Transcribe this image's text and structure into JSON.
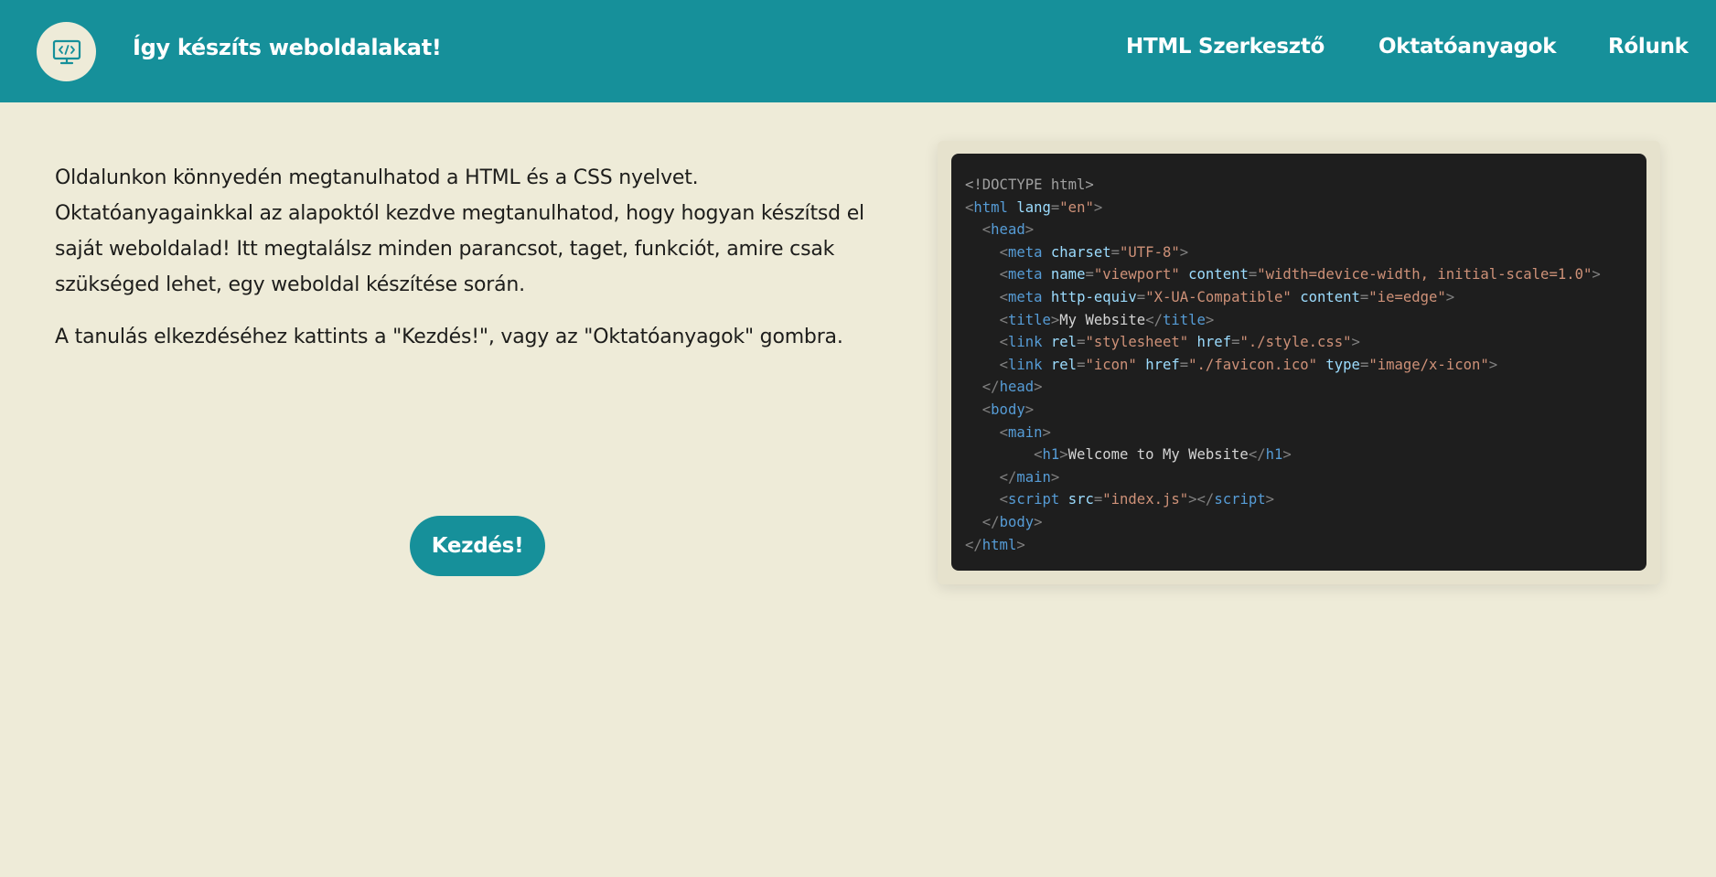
{
  "header": {
    "site_title": "Így készíts weboldalakat!",
    "logo_icon": "code-monitor-icon",
    "nav": [
      {
        "label": "HTML Szerkesztő"
      },
      {
        "label": "Oktatóanyagok"
      },
      {
        "label": "Rólunk"
      }
    ]
  },
  "intro": {
    "paragraph1": "Oldalunkon könnyedén megtanulhatod a HTML és a CSS nyelvet. Oktatóanyagainkkal az alapoktól kezdve megtanulhatod, hogy hogyan készítsd el saját weboldalad! Itt megtalálsz minden parancsot, taget, funkciót, amire csak szükséged lehet, egy weboldal készítése során.",
    "paragraph2": "A tanulás elkezdéséhez kattints a \"Kezdés!\", vagy az \"Oktatóanyagok\" gombra."
  },
  "start_button": {
    "label": "Kezdés!"
  },
  "colors": {
    "accent": "#16909a",
    "background": "#eeebd8",
    "code_bg": "#1e1e1e"
  },
  "code_sample": {
    "lines": [
      {
        "indent": 0,
        "tokens": [
          {
            "t": "doc",
            "v": "<!DOCTYPE html>"
          }
        ]
      },
      {
        "indent": 0,
        "tokens": [
          {
            "t": "punc",
            "v": "<"
          },
          {
            "t": "tag",
            "v": "html"
          },
          {
            "t": "text",
            "v": " "
          },
          {
            "t": "attr",
            "v": "lang"
          },
          {
            "t": "punc",
            "v": "="
          },
          {
            "t": "str",
            "v": "\"en\""
          },
          {
            "t": "punc",
            "v": ">"
          }
        ]
      },
      {
        "indent": 2,
        "tokens": [
          {
            "t": "punc",
            "v": "<"
          },
          {
            "t": "tag",
            "v": "head"
          },
          {
            "t": "punc",
            "v": ">"
          }
        ]
      },
      {
        "indent": 4,
        "tokens": [
          {
            "t": "punc",
            "v": "<"
          },
          {
            "t": "tag",
            "v": "meta"
          },
          {
            "t": "text",
            "v": " "
          },
          {
            "t": "attr",
            "v": "charset"
          },
          {
            "t": "punc",
            "v": "="
          },
          {
            "t": "str",
            "v": "\"UTF-8\""
          },
          {
            "t": "punc",
            "v": ">"
          }
        ]
      },
      {
        "indent": 4,
        "tokens": [
          {
            "t": "punc",
            "v": "<"
          },
          {
            "t": "tag",
            "v": "meta"
          },
          {
            "t": "text",
            "v": " "
          },
          {
            "t": "attr",
            "v": "name"
          },
          {
            "t": "punc",
            "v": "="
          },
          {
            "t": "str",
            "v": "\"viewport\""
          },
          {
            "t": "text",
            "v": " "
          },
          {
            "t": "attr",
            "v": "content"
          },
          {
            "t": "punc",
            "v": "="
          },
          {
            "t": "str",
            "v": "\"width=device-width, initial-scale=1.0\""
          },
          {
            "t": "punc",
            "v": ">"
          }
        ]
      },
      {
        "indent": 4,
        "tokens": [
          {
            "t": "punc",
            "v": "<"
          },
          {
            "t": "tag",
            "v": "meta"
          },
          {
            "t": "text",
            "v": " "
          },
          {
            "t": "attr",
            "v": "http-equiv"
          },
          {
            "t": "punc",
            "v": "="
          },
          {
            "t": "str",
            "v": "\"X-UA-Compatible\""
          },
          {
            "t": "text",
            "v": " "
          },
          {
            "t": "attr",
            "v": "content"
          },
          {
            "t": "punc",
            "v": "="
          },
          {
            "t": "str",
            "v": "\"ie=edge\""
          },
          {
            "t": "punc",
            "v": ">"
          }
        ]
      },
      {
        "indent": 4,
        "tokens": [
          {
            "t": "punc",
            "v": "<"
          },
          {
            "t": "tag",
            "v": "title"
          },
          {
            "t": "punc",
            "v": ">"
          },
          {
            "t": "text",
            "v": "My Website"
          },
          {
            "t": "punc",
            "v": "</"
          },
          {
            "t": "tag",
            "v": "title"
          },
          {
            "t": "punc",
            "v": ">"
          }
        ]
      },
      {
        "indent": 4,
        "tokens": [
          {
            "t": "punc",
            "v": "<"
          },
          {
            "t": "tag",
            "v": "link"
          },
          {
            "t": "text",
            "v": " "
          },
          {
            "t": "attr",
            "v": "rel"
          },
          {
            "t": "punc",
            "v": "="
          },
          {
            "t": "str",
            "v": "\"stylesheet\""
          },
          {
            "t": "text",
            "v": " "
          },
          {
            "t": "attr",
            "v": "href"
          },
          {
            "t": "punc",
            "v": "="
          },
          {
            "t": "str",
            "v": "\"./style.css\""
          },
          {
            "t": "punc",
            "v": ">"
          }
        ]
      },
      {
        "indent": 4,
        "tokens": [
          {
            "t": "punc",
            "v": "<"
          },
          {
            "t": "tag",
            "v": "link"
          },
          {
            "t": "text",
            "v": " "
          },
          {
            "t": "attr",
            "v": "rel"
          },
          {
            "t": "punc",
            "v": "="
          },
          {
            "t": "str",
            "v": "\"icon\""
          },
          {
            "t": "text",
            "v": " "
          },
          {
            "t": "attr",
            "v": "href"
          },
          {
            "t": "punc",
            "v": "="
          },
          {
            "t": "str",
            "v": "\"./favicon.ico\""
          },
          {
            "t": "text",
            "v": " "
          },
          {
            "t": "attr",
            "v": "type"
          },
          {
            "t": "punc",
            "v": "="
          },
          {
            "t": "str",
            "v": "\"image/x-icon\""
          },
          {
            "t": "punc",
            "v": ">"
          }
        ]
      },
      {
        "indent": 2,
        "tokens": [
          {
            "t": "punc",
            "v": "</"
          },
          {
            "t": "tag",
            "v": "head"
          },
          {
            "t": "punc",
            "v": ">"
          }
        ]
      },
      {
        "indent": 2,
        "tokens": [
          {
            "t": "punc",
            "v": "<"
          },
          {
            "t": "tag",
            "v": "body"
          },
          {
            "t": "punc",
            "v": ">"
          }
        ]
      },
      {
        "indent": 4,
        "tokens": [
          {
            "t": "punc",
            "v": "<"
          },
          {
            "t": "tag",
            "v": "main"
          },
          {
            "t": "punc",
            "v": ">"
          }
        ]
      },
      {
        "indent": 8,
        "tokens": [
          {
            "t": "punc",
            "v": "<"
          },
          {
            "t": "tag",
            "v": "h1"
          },
          {
            "t": "punc",
            "v": ">"
          },
          {
            "t": "text",
            "v": "Welcome to My Website"
          },
          {
            "t": "punc",
            "v": "</"
          },
          {
            "t": "tag",
            "v": "h1"
          },
          {
            "t": "punc",
            "v": ">"
          }
        ]
      },
      {
        "indent": 4,
        "tokens": [
          {
            "t": "punc",
            "v": "</"
          },
          {
            "t": "tag",
            "v": "main"
          },
          {
            "t": "punc",
            "v": ">"
          }
        ]
      },
      {
        "indent": 4,
        "tokens": [
          {
            "t": "punc",
            "v": "<"
          },
          {
            "t": "tag",
            "v": "script"
          },
          {
            "t": "text",
            "v": " "
          },
          {
            "t": "attr",
            "v": "src"
          },
          {
            "t": "punc",
            "v": "="
          },
          {
            "t": "str",
            "v": "\"index.js\""
          },
          {
            "t": "punc",
            "v": "></"
          },
          {
            "t": "tag",
            "v": "script"
          },
          {
            "t": "punc",
            "v": ">"
          }
        ]
      },
      {
        "indent": 2,
        "tokens": [
          {
            "t": "punc",
            "v": "</"
          },
          {
            "t": "tag",
            "v": "body"
          },
          {
            "t": "punc",
            "v": ">"
          }
        ]
      },
      {
        "indent": 0,
        "tokens": [
          {
            "t": "punc",
            "v": "</"
          },
          {
            "t": "tag",
            "v": "html"
          },
          {
            "t": "punc",
            "v": ">"
          }
        ]
      }
    ]
  }
}
